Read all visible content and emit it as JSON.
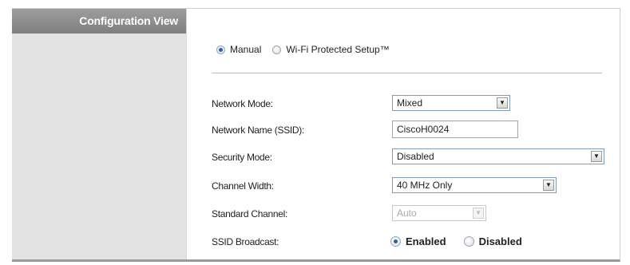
{
  "sidebar": {
    "title": "Configuration View"
  },
  "setup_mode": {
    "options": [
      "Manual",
      "Wi-Fi Protected Setup™"
    ],
    "selected": "Manual"
  },
  "form": {
    "network_mode": {
      "label": "Network Mode:",
      "value": "Mixed"
    },
    "ssid": {
      "label": "Network Name (SSID):",
      "value": "CiscoH0024"
    },
    "security_mode": {
      "label": "Security Mode:",
      "value": "Disabled"
    },
    "channel_width": {
      "label": "Channel Width:",
      "value": "40 MHz Only"
    },
    "standard_channel": {
      "label": "Standard Channel:",
      "value": "Auto"
    },
    "ssid_broadcast": {
      "label": "SSID Broadcast:",
      "options": [
        "Enabled",
        "Disabled"
      ],
      "selected": "Enabled"
    }
  },
  "icons": {
    "dropdown": "chevron-down-icon"
  }
}
